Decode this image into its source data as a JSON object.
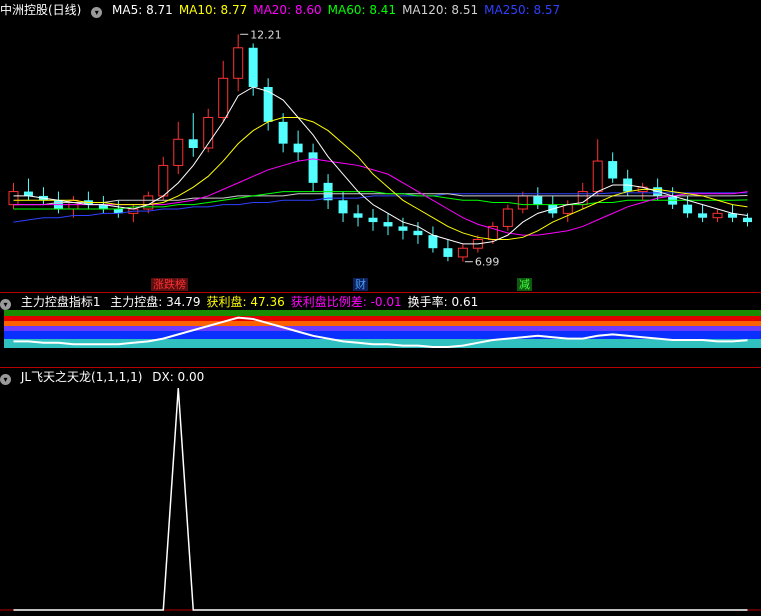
{
  "panel1": {
    "title": "中洲控股(日线)",
    "ma": [
      {
        "label": "MA5: 8.71",
        "color": "#ffffff"
      },
      {
        "label": "MA10: 8.77",
        "color": "#ffff00"
      },
      {
        "label": "MA20: 8.60",
        "color": "#ff00ff"
      },
      {
        "label": "MA60: 8.41",
        "color": "#00ff00"
      },
      {
        "label": "MA120: 8.51",
        "color": "#d0d0d0"
      },
      {
        "label": "MA250: 8.57",
        "color": "#3040ff"
      }
    ],
    "high_label": "12.21",
    "low_label": "6.99",
    "tags": [
      {
        "text": "涨跌榜",
        "color": "#ff3030",
        "bg": "#5a1010"
      },
      {
        "text": "财",
        "color": "#40a0ff",
        "bg": "#10205a"
      },
      {
        "text": "减",
        "color": "#40ff40",
        "bg": "#105a10"
      }
    ]
  },
  "panel2": {
    "title": "主力控盘指标1",
    "items": [
      {
        "label": "主力控盘: 34.79",
        "color": "#ffffff"
      },
      {
        "label": "获利盘: 47.36",
        "color": "#ffff00"
      },
      {
        "label": "获利盘比例差: -0.01",
        "color": "#ff00ff"
      },
      {
        "label": "换手率: 0.61",
        "color": "#ffffff"
      }
    ]
  },
  "panel3": {
    "title": "JL飞天之天龙(1,1,1,1)",
    "items": [
      {
        "label": "DX: 0.00",
        "color": "#ffffff"
      }
    ]
  },
  "chart_data": {
    "type": "candlestick",
    "high": 12.21,
    "low": 6.99,
    "ma_last": {
      "MA5": 8.71,
      "MA10": 8.77,
      "MA20": 8.6,
      "MA60": 8.41,
      "MA120": 8.51,
      "MA250": 8.57
    },
    "ohlc": [
      [
        8.3,
        8.8,
        8.2,
        8.6
      ],
      [
        8.6,
        8.9,
        8.4,
        8.5
      ],
      [
        8.5,
        8.7,
        8.3,
        8.4
      ],
      [
        8.4,
        8.6,
        8.1,
        8.2
      ],
      [
        8.2,
        8.5,
        8.0,
        8.4
      ],
      [
        8.4,
        8.6,
        8.2,
        8.3
      ],
      [
        8.3,
        8.5,
        8.1,
        8.2
      ],
      [
        8.2,
        8.4,
        8.0,
        8.1
      ],
      [
        8.1,
        8.3,
        7.9,
        8.2
      ],
      [
        8.2,
        8.6,
        8.1,
        8.5
      ],
      [
        8.5,
        9.4,
        8.4,
        9.2
      ],
      [
        9.2,
        10.2,
        9.0,
        9.8
      ],
      [
        9.8,
        10.4,
        9.4,
        9.6
      ],
      [
        9.6,
        10.5,
        9.5,
        10.3
      ],
      [
        10.3,
        11.6,
        10.2,
        11.2
      ],
      [
        11.2,
        12.21,
        10.9,
        11.9
      ],
      [
        11.9,
        12.0,
        10.8,
        11.0
      ],
      [
        11.0,
        11.2,
        10.0,
        10.2
      ],
      [
        10.2,
        10.4,
        9.5,
        9.7
      ],
      [
        9.7,
        10.0,
        9.3,
        9.5
      ],
      [
        9.5,
        9.7,
        8.6,
        8.8
      ],
      [
        8.8,
        9.0,
        8.2,
        8.4
      ],
      [
        8.4,
        8.6,
        7.9,
        8.1
      ],
      [
        8.1,
        8.3,
        7.8,
        8.0
      ],
      [
        8.0,
        8.2,
        7.7,
        7.9
      ],
      [
        7.9,
        8.1,
        7.6,
        7.8
      ],
      [
        7.8,
        8.0,
        7.5,
        7.7
      ],
      [
        7.7,
        7.9,
        7.4,
        7.6
      ],
      [
        7.6,
        7.8,
        7.2,
        7.3
      ],
      [
        7.3,
        7.5,
        7.0,
        7.1
      ],
      [
        7.1,
        7.4,
        6.99,
        7.3
      ],
      [
        7.3,
        7.6,
        7.2,
        7.5
      ],
      [
        7.5,
        7.9,
        7.4,
        7.8
      ],
      [
        7.8,
        8.3,
        7.7,
        8.2
      ],
      [
        8.2,
        8.6,
        8.1,
        8.5
      ],
      [
        8.5,
        8.7,
        8.2,
        8.3
      ],
      [
        8.3,
        8.5,
        8.0,
        8.1
      ],
      [
        8.1,
        8.4,
        7.9,
        8.3
      ],
      [
        8.3,
        8.8,
        8.2,
        8.6
      ],
      [
        8.6,
        9.8,
        8.5,
        9.3
      ],
      [
        9.3,
        9.5,
        8.8,
        8.9
      ],
      [
        8.9,
        9.1,
        8.5,
        8.6
      ],
      [
        8.6,
        8.8,
        8.4,
        8.7
      ],
      [
        8.7,
        8.9,
        8.4,
        8.5
      ],
      [
        8.5,
        8.7,
        8.2,
        8.3
      ],
      [
        8.3,
        8.5,
        8.0,
        8.1
      ],
      [
        8.1,
        8.3,
        7.9,
        8.0
      ],
      [
        8.0,
        8.2,
        7.9,
        8.1
      ],
      [
        8.1,
        8.3,
        7.9,
        8.0
      ],
      [
        8.0,
        8.1,
        7.8,
        7.9
      ]
    ],
    "ma5": [
      8.5,
      8.5,
      8.45,
      8.4,
      8.35,
      8.3,
      8.3,
      8.25,
      8.2,
      8.3,
      8.5,
      8.8,
      9.2,
      9.7,
      10.2,
      10.8,
      11.0,
      10.9,
      10.7,
      10.3,
      9.9,
      9.4,
      9.0,
      8.6,
      8.3,
      8.1,
      7.9,
      7.8,
      7.6,
      7.5,
      7.4,
      7.4,
      7.45,
      7.6,
      7.9,
      8.1,
      8.2,
      8.3,
      8.35,
      8.6,
      8.75,
      8.75,
      8.7,
      8.6,
      8.5,
      8.4,
      8.3,
      8.2,
      8.1,
      8.05
    ],
    "ma10": [
      8.4,
      8.4,
      8.4,
      8.4,
      8.4,
      8.35,
      8.35,
      8.3,
      8.3,
      8.3,
      8.35,
      8.5,
      8.7,
      8.95,
      9.3,
      9.7,
      10.0,
      10.2,
      10.3,
      10.3,
      10.2,
      10.0,
      9.7,
      9.4,
      9.0,
      8.7,
      8.4,
      8.2,
      8.0,
      7.8,
      7.65,
      7.55,
      7.5,
      7.5,
      7.55,
      7.7,
      7.9,
      8.05,
      8.2,
      8.35,
      8.5,
      8.6,
      8.65,
      8.65,
      8.6,
      8.55,
      8.5,
      8.4,
      8.3,
      8.25
    ],
    "ma20": [
      8.3,
      8.3,
      8.3,
      8.3,
      8.3,
      8.3,
      8.3,
      8.3,
      8.3,
      8.3,
      8.3,
      8.35,
      8.4,
      8.5,
      8.65,
      8.8,
      8.95,
      9.1,
      9.2,
      9.3,
      9.35,
      9.3,
      9.25,
      9.2,
      9.1,
      9.0,
      8.8,
      8.6,
      8.4,
      8.2,
      8.0,
      7.85,
      7.75,
      7.65,
      7.6,
      7.6,
      7.65,
      7.7,
      7.8,
      7.95,
      8.1,
      8.25,
      8.35,
      8.45,
      8.5,
      8.55,
      8.55,
      8.55,
      8.55,
      8.6
    ],
    "ma60": [
      8.2,
      8.2,
      8.2,
      8.2,
      8.2,
      8.2,
      8.2,
      8.2,
      8.25,
      8.25,
      8.25,
      8.3,
      8.3,
      8.35,
      8.4,
      8.45,
      8.5,
      8.55,
      8.6,
      8.6,
      8.6,
      8.6,
      8.6,
      8.6,
      8.6,
      8.55,
      8.55,
      8.5,
      8.5,
      8.45,
      8.4,
      8.4,
      8.35,
      8.35,
      8.3,
      8.3,
      8.3,
      8.3,
      8.3,
      8.35,
      8.35,
      8.4,
      8.4,
      8.4,
      8.4,
      8.4,
      8.4,
      8.4,
      8.4,
      8.41
    ],
    "ma120": [
      8.3,
      8.3,
      8.3,
      8.35,
      8.35,
      8.35,
      8.35,
      8.4,
      8.4,
      8.4,
      8.4,
      8.4,
      8.45,
      8.45,
      8.45,
      8.5,
      8.5,
      8.5,
      8.5,
      8.55,
      8.55,
      8.55,
      8.55,
      8.55,
      8.55,
      8.55,
      8.55,
      8.55,
      8.55,
      8.55,
      8.5,
      8.5,
      8.5,
      8.5,
      8.5,
      8.5,
      8.5,
      8.5,
      8.5,
      8.5,
      8.5,
      8.5,
      8.5,
      8.5,
      8.5,
      8.5,
      8.5,
      8.5,
      8.5,
      8.51
    ],
    "ma250": [
      7.9,
      7.95,
      8.0,
      8.0,
      8.05,
      8.05,
      8.1,
      8.1,
      8.15,
      8.15,
      8.2,
      8.2,
      8.25,
      8.25,
      8.3,
      8.3,
      8.35,
      8.35,
      8.4,
      8.4,
      8.4,
      8.45,
      8.45,
      8.45,
      8.5,
      8.5,
      8.5,
      8.5,
      8.5,
      8.55,
      8.55,
      8.55,
      8.55,
      8.55,
      8.55,
      8.55,
      8.55,
      8.55,
      8.55,
      8.55,
      8.57,
      8.57,
      8.57,
      8.57,
      8.57,
      8.57,
      8.57,
      8.57,
      8.57,
      8.57
    ],
    "control_line": [
      34,
      34,
      33,
      33,
      32,
      32,
      32,
      32,
      33,
      34,
      36,
      39,
      42,
      45,
      48,
      51,
      50,
      47,
      44,
      41,
      38,
      36,
      34,
      33,
      32,
      32,
      31,
      31,
      30,
      30,
      31,
      33,
      35,
      36,
      37,
      38,
      37,
      36,
      36,
      38,
      39,
      38,
      37,
      36,
      35,
      35,
      35,
      34,
      34,
      34.79
    ],
    "dx": [
      0,
      0,
      0,
      0,
      0,
      0,
      0,
      0,
      0,
      0,
      0,
      100,
      0,
      0,
      0,
      0,
      0,
      0,
      0,
      0,
      0,
      0,
      0,
      0,
      0,
      0,
      0,
      0,
      0,
      0,
      0,
      0,
      0,
      0,
      0,
      0,
      0,
      0,
      0,
      0,
      0,
      0,
      0,
      0,
      0,
      0,
      0,
      0,
      0,
      0
    ]
  }
}
